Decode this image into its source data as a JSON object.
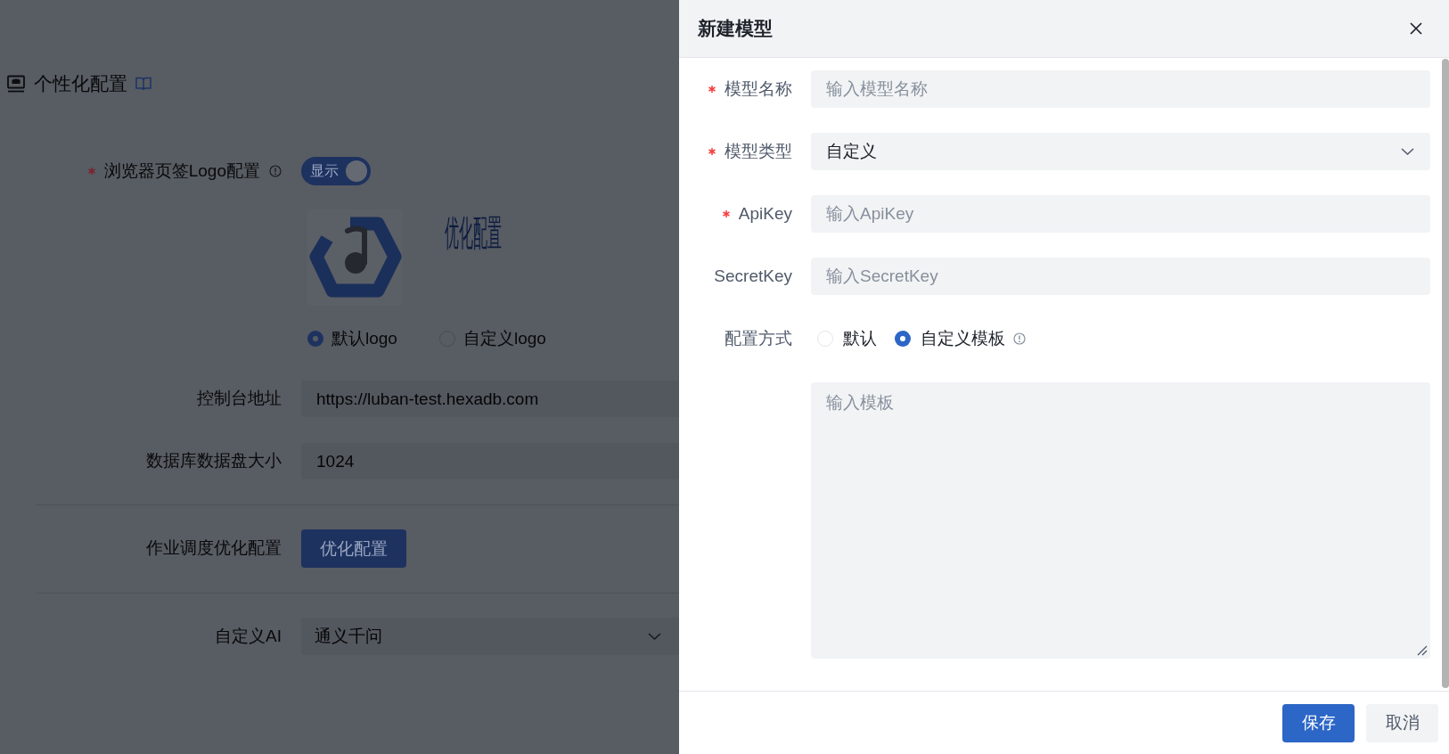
{
  "page": {
    "title": "个性化配置",
    "logo_setting": {
      "label": "浏览器页签Logo配置",
      "required": true,
      "switch": {
        "label": "显示",
        "on": true
      },
      "preview_text": "优化配置",
      "options": [
        {
          "label": "默认logo",
          "selected": true
        },
        {
          "label": "自定义logo",
          "selected": false
        }
      ]
    },
    "fields": [
      {
        "label": "控制台地址",
        "value": "https://luban-test.hexadb.com"
      },
      {
        "label": "数据库数据盘大小",
        "value": "1024"
      }
    ],
    "schedule": {
      "label": "作业调度优化配置",
      "button": "优化配置"
    },
    "custom_ai": {
      "label": "自定义AI",
      "value": "通义千问"
    }
  },
  "drawer": {
    "title": "新建模型",
    "fields": [
      {
        "kind": "input",
        "label": "模型名称",
        "required": true,
        "placeholder": "输入模型名称"
      },
      {
        "kind": "select",
        "label": "模型类型",
        "required": true,
        "value": "自定义"
      },
      {
        "kind": "input",
        "label": "ApiKey",
        "required": true,
        "placeholder": "输入ApiKey"
      },
      {
        "kind": "input",
        "label": "SecretKey",
        "required": false,
        "placeholder": "输入SecretKey"
      },
      {
        "kind": "radio",
        "label": "配置方式",
        "required": false,
        "options": [
          {
            "label": "默认",
            "selected": false
          },
          {
            "label": "自定义模板",
            "selected": true
          }
        ]
      },
      {
        "kind": "textarea",
        "placeholder": "输入模板"
      }
    ],
    "buttons": [
      {
        "kind": "primary",
        "label": "保存"
      },
      {
        "kind": "secondary",
        "label": "取消"
      }
    ]
  }
}
